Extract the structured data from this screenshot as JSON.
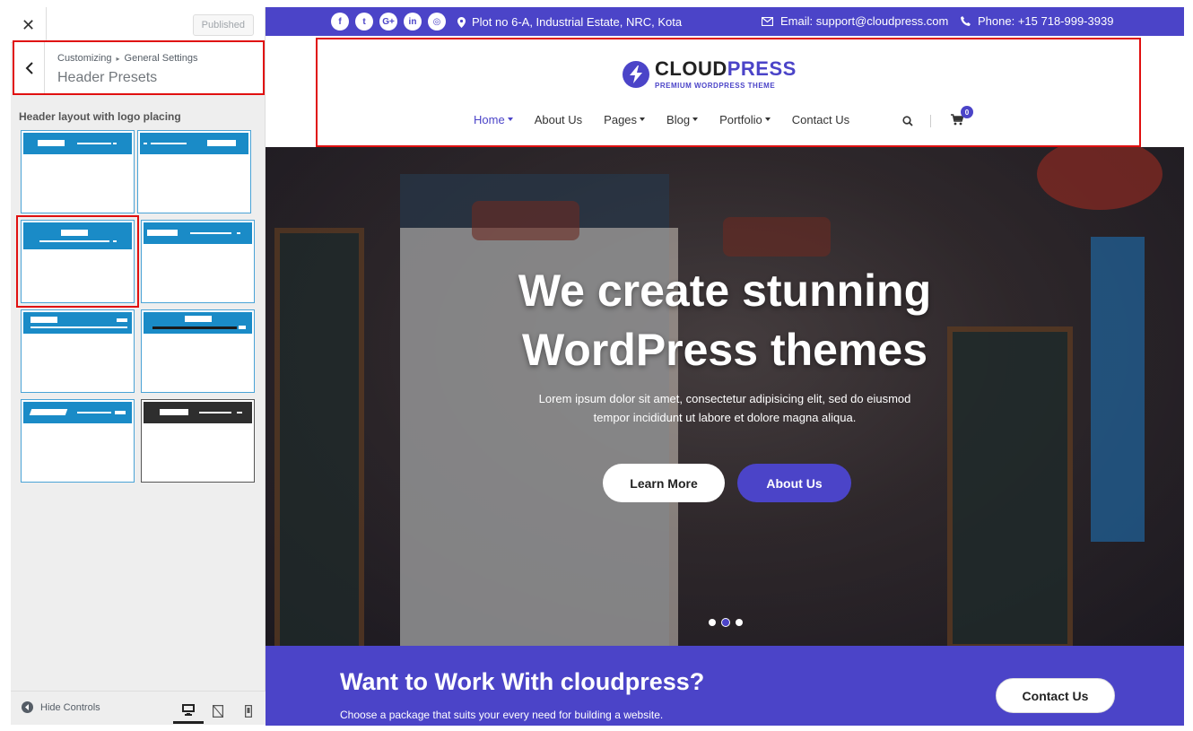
{
  "customizer": {
    "close_label": "✕",
    "published_label": "Published",
    "breadcrumb": {
      "root": "Customizing",
      "separator": "▸",
      "section": "General Settings"
    },
    "section_title": "Header Presets",
    "control_label": "Header layout with logo placing",
    "selected_preset_index": 2,
    "hide_controls_label": "Hide Controls",
    "devices": [
      "desktop",
      "tablet",
      "mobile"
    ],
    "active_device": "desktop"
  },
  "site": {
    "colors": {
      "accent": "#4b44c8",
      "highlight": "#e01010",
      "preset_blue": "#1a8bc7"
    },
    "topbar": {
      "socials": [
        "facebook-icon",
        "twitter-icon",
        "google-plus-icon",
        "linkedin-icon",
        "instagram-icon"
      ],
      "social_glyphs": [
        "f",
        "t",
        "G+",
        "in",
        "◎"
      ],
      "address": "Plot no 6-A, Industrial Estate, NRC, Kota",
      "email": "Email: support@cloudpress.com",
      "phone": "Phone: +15 718-999-3939"
    },
    "logo": {
      "name_part1": "CLOUD",
      "name_part2": "PRESS",
      "tagline": "PREMIUM WORDPRESS THEME"
    },
    "nav": {
      "items": [
        {
          "label": "Home",
          "dropdown": true,
          "active": true
        },
        {
          "label": "About Us",
          "dropdown": false,
          "active": false
        },
        {
          "label": "Pages",
          "dropdown": true,
          "active": false
        },
        {
          "label": "Blog",
          "dropdown": true,
          "active": false
        },
        {
          "label": "Portfolio",
          "dropdown": true,
          "active": false
        },
        {
          "label": "Contact Us",
          "dropdown": false,
          "active": false
        }
      ],
      "cart_count": "0"
    },
    "hero": {
      "title_line1": "We create stunning",
      "title_line2": "WordPress themes",
      "sub_line1": "Lorem ipsum dolor sit amet, consectetur adipisicing elit, sed do eiusmod",
      "sub_line2": "tempor incididunt ut labore et dolore magna aliqua.",
      "learn_more_label": "Learn More",
      "about_us_label": "About Us",
      "slides": 3,
      "active_slide": 1
    },
    "cta": {
      "title": "Want to Work With cloudpress?",
      "subtitle": "Choose a package that suits your every need for building a website.",
      "button_label": "Contact Us"
    }
  }
}
